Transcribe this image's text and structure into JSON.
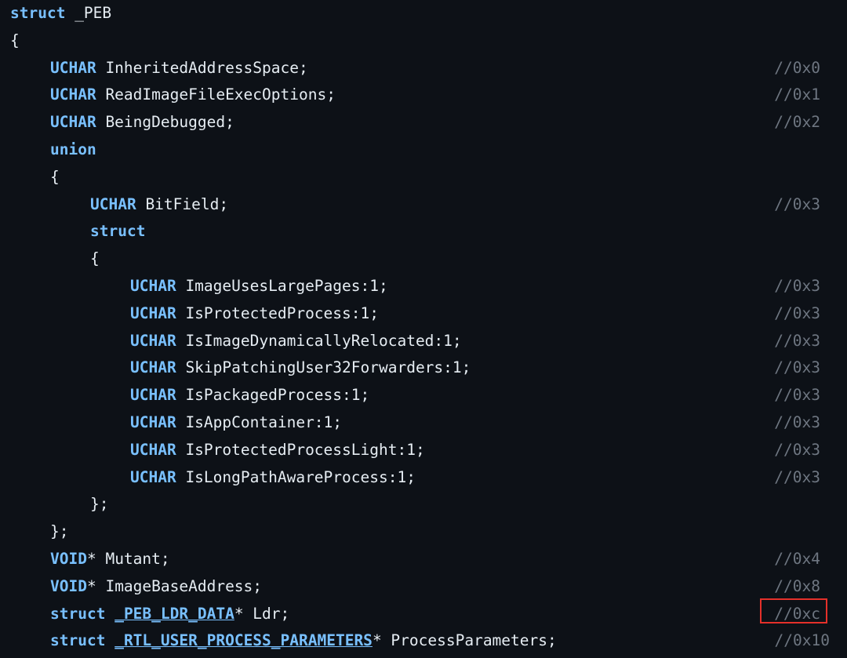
{
  "lines": [
    {
      "indent": 0,
      "parts": [
        {
          "t": "struct",
          "c": "kw"
        },
        {
          "t": " _PEB",
          "c": "tx"
        }
      ],
      "comment": ""
    },
    {
      "indent": 0,
      "parts": [
        {
          "t": "{",
          "c": "tx"
        }
      ],
      "comment": ""
    },
    {
      "indent": 1,
      "parts": [
        {
          "t": "UCHAR",
          "c": "kw"
        },
        {
          "t": " InheritedAddressSpace;",
          "c": "tx"
        }
      ],
      "comment": "//0x0"
    },
    {
      "indent": 1,
      "parts": [
        {
          "t": "UCHAR",
          "c": "kw"
        },
        {
          "t": " ReadImageFileExecOptions;",
          "c": "tx"
        }
      ],
      "comment": "//0x1"
    },
    {
      "indent": 1,
      "parts": [
        {
          "t": "UCHAR",
          "c": "kw"
        },
        {
          "t": " BeingDebugged;",
          "c": "tx"
        }
      ],
      "comment": "//0x2"
    },
    {
      "indent": 1,
      "parts": [
        {
          "t": "union",
          "c": "kw"
        }
      ],
      "comment": ""
    },
    {
      "indent": 1,
      "parts": [
        {
          "t": "{",
          "c": "tx"
        }
      ],
      "comment": ""
    },
    {
      "indent": 2,
      "parts": [
        {
          "t": "UCHAR",
          "c": "kw"
        },
        {
          "t": " BitField;",
          "c": "tx"
        }
      ],
      "comment": "//0x3"
    },
    {
      "indent": 2,
      "parts": [
        {
          "t": "struct",
          "c": "kw"
        }
      ],
      "comment": ""
    },
    {
      "indent": 2,
      "parts": [
        {
          "t": "{",
          "c": "tx"
        }
      ],
      "comment": ""
    },
    {
      "indent": 3,
      "parts": [
        {
          "t": "UCHAR",
          "c": "kw"
        },
        {
          "t": " ImageUsesLargePages:1;",
          "c": "tx"
        }
      ],
      "comment": "//0x3"
    },
    {
      "indent": 3,
      "parts": [
        {
          "t": "UCHAR",
          "c": "kw"
        },
        {
          "t": " IsProtectedProcess:1;",
          "c": "tx"
        }
      ],
      "comment": "//0x3"
    },
    {
      "indent": 3,
      "parts": [
        {
          "t": "UCHAR",
          "c": "kw"
        },
        {
          "t": " IsImageDynamicallyRelocated:1;",
          "c": "tx"
        }
      ],
      "comment": "//0x3"
    },
    {
      "indent": 3,
      "parts": [
        {
          "t": "UCHAR",
          "c": "kw"
        },
        {
          "t": " SkipPatchingUser32Forwarders:1;",
          "c": "tx"
        }
      ],
      "comment": "//0x3"
    },
    {
      "indent": 3,
      "parts": [
        {
          "t": "UCHAR",
          "c": "kw"
        },
        {
          "t": " IsPackagedProcess:1;",
          "c": "tx"
        }
      ],
      "comment": "//0x3"
    },
    {
      "indent": 3,
      "parts": [
        {
          "t": "UCHAR",
          "c": "kw"
        },
        {
          "t": " IsAppContainer:1;",
          "c": "tx"
        }
      ],
      "comment": "//0x3"
    },
    {
      "indent": 3,
      "parts": [
        {
          "t": "UCHAR",
          "c": "kw"
        },
        {
          "t": " IsProtectedProcessLight:1;",
          "c": "tx"
        }
      ],
      "comment": "//0x3"
    },
    {
      "indent": 3,
      "parts": [
        {
          "t": "UCHAR",
          "c": "kw"
        },
        {
          "t": " IsLongPathAwareProcess:1;",
          "c": "tx"
        }
      ],
      "comment": "//0x3"
    },
    {
      "indent": 2,
      "parts": [
        {
          "t": "};",
          "c": "tx"
        }
      ],
      "comment": ""
    },
    {
      "indent": 1,
      "parts": [
        {
          "t": "};",
          "c": "tx"
        }
      ],
      "comment": ""
    },
    {
      "indent": 1,
      "parts": [
        {
          "t": "VOID",
          "c": "kw"
        },
        {
          "t": "* Mutant;",
          "c": "tx"
        }
      ],
      "comment": "//0x4"
    },
    {
      "indent": 1,
      "parts": [
        {
          "t": "VOID",
          "c": "kw"
        },
        {
          "t": "* ImageBaseAddress;",
          "c": "tx"
        }
      ],
      "comment": "//0x8"
    },
    {
      "indent": 1,
      "parts": [
        {
          "t": "struct",
          "c": "kw"
        },
        {
          "t": " ",
          "c": "tx"
        },
        {
          "t": "_PEB_LDR_DATA",
          "c": "kw ul"
        },
        {
          "t": "* Ldr;",
          "c": "tx"
        }
      ],
      "comment": "//0xc",
      "highlight": true
    },
    {
      "indent": 1,
      "parts": [
        {
          "t": "struct",
          "c": "kw"
        },
        {
          "t": " ",
          "c": "tx"
        },
        {
          "t": "_RTL_USER_PROCESS_PARAMETERS",
          "c": "kw ul"
        },
        {
          "t": "* ProcessParameters;",
          "c": "tx"
        }
      ],
      "comment": "//0x10"
    }
  ],
  "colors": {
    "background": "#0d1117",
    "keyword": "#79c0ff",
    "text": "#e6edf3",
    "comment": "#6e7681",
    "highlight_box": "#e5302a"
  }
}
